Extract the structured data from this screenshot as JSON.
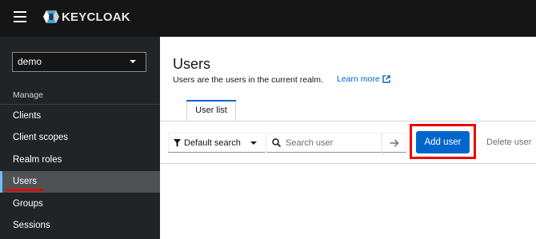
{
  "header": {
    "logo_text": "KEYCLOAK",
    "menu_icon": "hamburger-icon",
    "colors": {
      "background": "#151515",
      "logo_accent": "#4d9ed6"
    }
  },
  "sidebar": {
    "realm": "demo",
    "section_title": "Manage",
    "items": [
      {
        "label": "Clients",
        "active": false
      },
      {
        "label": "Client scopes",
        "active": false
      },
      {
        "label": "Realm roles",
        "active": false
      },
      {
        "label": "Users",
        "active": true
      },
      {
        "label": "Groups",
        "active": false
      },
      {
        "label": "Sessions",
        "active": false
      }
    ],
    "colors": {
      "background": "#212427",
      "active": "#4f5255",
      "active_indicator": "#73bcf7"
    }
  },
  "main": {
    "title": "Users",
    "description": "Users are the users in the current realm.",
    "learn_more": "Learn more",
    "tabs": [
      {
        "label": "User list",
        "active": true
      }
    ],
    "toolbar": {
      "filter_label": "Default search",
      "search_placeholder": "Search user",
      "add_user_label": "Add user",
      "delete_user_label": "Delete user"
    },
    "colors": {
      "primary": "#0066cc",
      "highlight": "#ee0000"
    }
  }
}
